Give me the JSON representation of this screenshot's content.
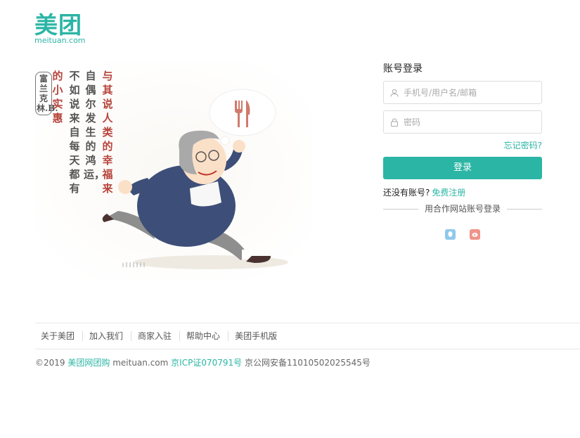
{
  "brand": {
    "name_cn": "美团",
    "name_en": "meituan.com",
    "color": "#2bb5a5"
  },
  "illustration": {
    "quote_columns": [
      {
        "text": "与其说人类的幸福来",
        "color": "red"
      },
      {
        "text": "自偶尔发生的鸿运，",
        "color": "dark"
      },
      {
        "text": "不如说来自每天都有",
        "color": "dark"
      },
      {
        "text": "的小实惠",
        "color": "red"
      }
    ],
    "author": "富兰克林.B.",
    "icon": "fork-knife-icon"
  },
  "login": {
    "title": "账号登录",
    "username_placeholder": "手机号/用户名/邮箱",
    "password_placeholder": "密码",
    "forgot": "忘记密码?",
    "submit": "登录",
    "no_account": "还没有账号?",
    "register": "免费注册",
    "partner_title": "用合作网站账号登录",
    "partners": [
      "qq-icon",
      "weibo-icon"
    ]
  },
  "footer": {
    "links": [
      "关于美团",
      "加入我们",
      "商家入驻",
      "帮助中心",
      "美团手机版"
    ],
    "copyright_prefix": "©2019",
    "company": "美团网团购",
    "domain": "meituan.com",
    "icp": "京ICP证070791号",
    "police": "京公网安备11010502025545号"
  }
}
